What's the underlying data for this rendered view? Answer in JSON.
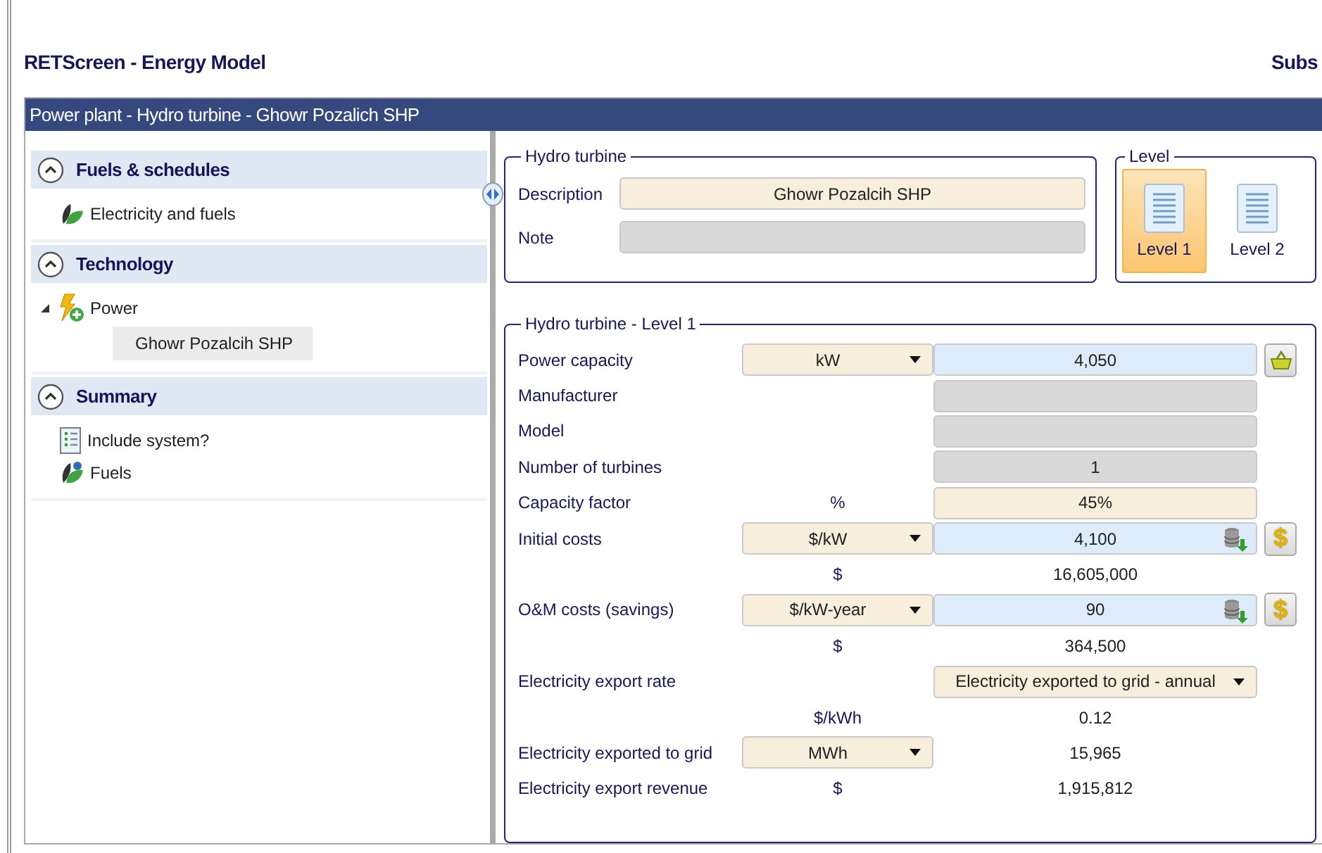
{
  "window": {
    "title": "RETScreen - Energy Model",
    "title_right": "Subs"
  },
  "breadcrumb": "Power plant - Hydro turbine - Ghowr Pozalich SHP",
  "sidebar": {
    "sections": [
      {
        "title": "Fuels & schedules",
        "expanded": true,
        "items": [
          {
            "kind": "fuel",
            "label": "Electricity and fuels"
          }
        ]
      },
      {
        "title": "Technology",
        "expanded": true,
        "items": [
          {
            "kind": "tree",
            "label": "Power",
            "expanded": true,
            "children": [
              {
                "label": "Ghowr Pozalcih SHP",
                "selected": true
              }
            ]
          }
        ]
      },
      {
        "title": "Summary",
        "expanded": true,
        "items": [
          {
            "kind": "checklist",
            "label": "Include system?"
          },
          {
            "kind": "fuel-cost",
            "label": "Fuels"
          }
        ]
      }
    ]
  },
  "hydro_turbine": {
    "legend": "Hydro turbine",
    "fields": [
      {
        "label": "Description",
        "value": "Ghowr Pozalcih SHP",
        "disabled": false
      },
      {
        "label": "Note",
        "disabled": true
      }
    ]
  },
  "level": {
    "legend": "Level",
    "options": [
      {
        "label": "Level 1",
        "selected": true
      },
      {
        "label": "Level 2",
        "selected": false
      }
    ]
  },
  "level_1": {
    "legend": "Hydro turbine - Level 1",
    "rows": [
      {
        "label": "Power capacity",
        "unit": {
          "kind": "dropdown",
          "text": "kW"
        },
        "value": {
          "kind": "input",
          "text": "4,050",
          "database": false
        },
        "action": {
          "kind": "basket"
        }
      },
      {
        "label": "Manufacturer",
        "value": {
          "kind": "disabled"
        }
      },
      {
        "label": "Model",
        "value": {
          "kind": "disabled"
        }
      },
      {
        "label": "Number of turbines",
        "value": {
          "kind": "disabled",
          "text": "1"
        }
      },
      {
        "label": "Capacity factor",
        "unit": {
          "kind": "text",
          "text": "%"
        },
        "value": {
          "kind": "entered",
          "text": "45%"
        }
      },
      {
        "label": "Initial costs",
        "unit": {
          "kind": "dropdown",
          "text": "$/kW"
        },
        "value": {
          "kind": "input",
          "text": "4,100",
          "database": true
        },
        "action": {
          "kind": "dollar",
          "label": "$"
        }
      },
      {
        "unit": {
          "kind": "text",
          "text": "$"
        },
        "value": {
          "kind": "plain",
          "text": "16,605,000"
        }
      },
      {
        "label": "O&M costs (savings)",
        "unit": {
          "kind": "dropdown",
          "text": "$/kW-year"
        },
        "value": {
          "kind": "input",
          "text": "90",
          "database": true
        },
        "action": {
          "kind": "dollar",
          "label": "$"
        }
      },
      {
        "unit": {
          "kind": "text",
          "text": "$"
        },
        "value": {
          "kind": "plain",
          "text": "364,500"
        }
      },
      {
        "label": "Electricity export rate",
        "value": {
          "kind": "dropdown",
          "text": "Electricity exported to grid - annual"
        }
      },
      {
        "unit": {
          "kind": "text",
          "text": "$/kWh"
        },
        "value": {
          "kind": "plain",
          "text": "0.12"
        }
      },
      {
        "label": "Electricity exported to grid",
        "unit": {
          "kind": "dropdown",
          "text": "MWh"
        },
        "value": {
          "kind": "plain",
          "text": "15,965"
        }
      },
      {
        "label": "Electricity export revenue",
        "unit": {
          "kind": "text",
          "text": "$"
        },
        "value": {
          "kind": "plain",
          "text": "1,915,812"
        }
      }
    ]
  }
}
